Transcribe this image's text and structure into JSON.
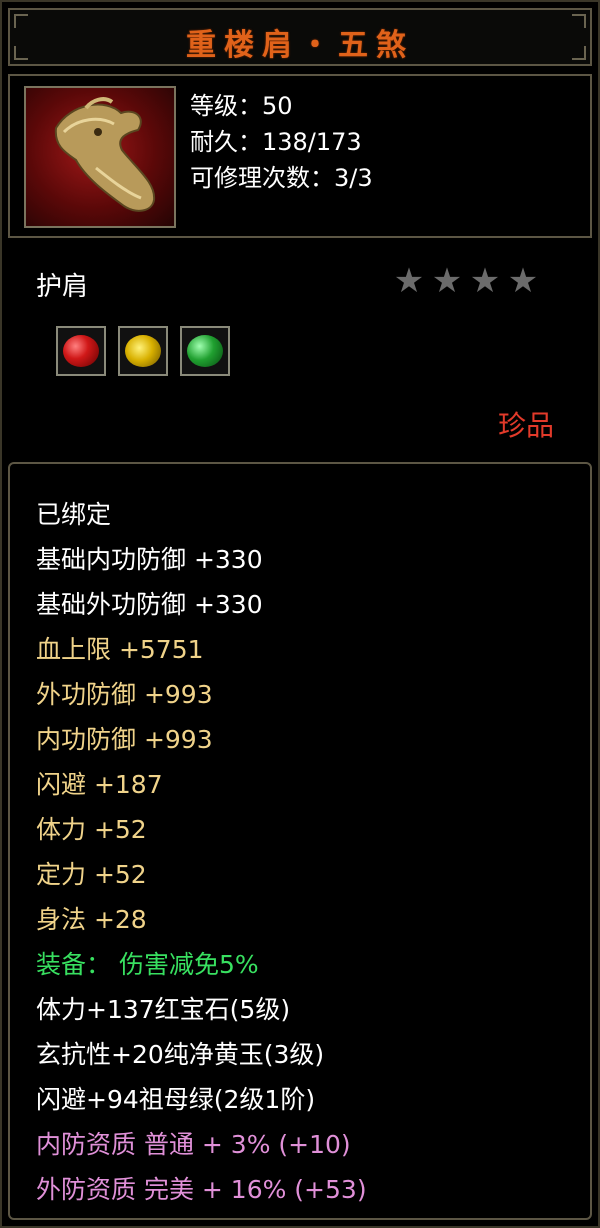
{
  "title": "重楼肩・五煞",
  "header": {
    "level": "等级：50",
    "durability": "耐久：138/173",
    "repairs": "可修理次数：3/3"
  },
  "item_type": "护肩",
  "stars": {
    "count": 4,
    "color": "#6b6b6b"
  },
  "gems": [
    "ruby-gem-icon",
    "topaz-gem-icon",
    "emerald-gem-icon"
  ],
  "quality": "珍品",
  "attributes": {
    "bound": "已绑定",
    "base_inner_def": "基础内功防御 +330",
    "base_outer_def": "基础外功防御 +330",
    "hp_max": "血上限 +5751",
    "outer_def": "外功防御 +993",
    "inner_def": "内功防御 +993",
    "dodge": "闪避 +187",
    "stamina": "体力 +52",
    "focus": "定力 +52",
    "agility": "身法 +28",
    "equip_effect": "装备： 伤害减免5%",
    "gem_1": "体力+137红宝石(5级)",
    "gem_2": "玄抗性+20纯净黄玉(3级)",
    "gem_3": "闪避+94祖母绿(2级1阶)",
    "inner_quality": "内防资质 普通 + 3% (+10)",
    "outer_quality": "外防资质 完美 + 16% (+53)"
  },
  "colors": {
    "title": "#e0621a",
    "quality": "#e23a2a",
    "gold_attr": "#f0d38a",
    "green_attr": "#38e060",
    "pink_attr": "#e090d8"
  }
}
